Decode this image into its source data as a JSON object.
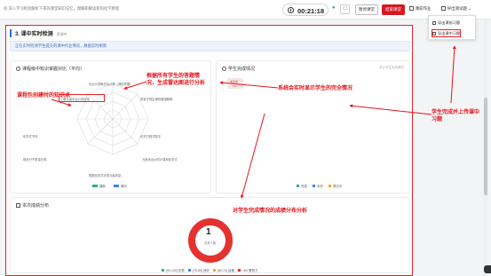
{
  "topbar": {
    "lesson_text": "风 深入学习经验解析下来的课堂知识记忆，理解和解读新的化学原理",
    "timer": "00:21:18",
    "pause_label": "暂停课堂",
    "end_label": "结束课堂",
    "menu": [
      "课前作业",
      "导出测试题"
    ]
  },
  "dropdown": {
    "options": [
      "导出课前习题",
      "导出课中习题"
    ]
  },
  "section": {
    "title": "3. 课中实时检测",
    "subtitle": "资源中",
    "info": "正在实时检测学生提交的课中作业情况，数据实时刷新"
  },
  "radar_card": {
    "title": "课程级中知识掌握对比（平均）",
    "labels": [
      "化合价的概念及计算（课前掌握）",
      "了解元素化合价的应用",
      "质量守恒定律的微观解释",
      "化学方程式配平",
      "元素化合价的计算和化学式",
      "根据化学式计算元素质量",
      "相对分子质量计算",
      "化学式书写"
    ],
    "legend": [
      {
        "name": "课前",
        "color": "#2ab573"
      },
      {
        "name": "课中",
        "color": "#3b82f6"
      }
    ]
  },
  "completion_card": {
    "title": "学生完成情况",
    "right_label": "共计学生完成情况",
    "tag_line1": "未完成",
    "tag_line2": "0人",
    "legend": [
      {
        "name": "完成",
        "color": "#2ab573"
      },
      {
        "name": "未完",
        "color": "#3b82f6"
      },
      {
        "name": "提交中",
        "color": "#f5a623"
      }
    ]
  },
  "score_card": {
    "title": "本次成绩分布",
    "donut_value": "1",
    "donut_label": "总考人数",
    "legend": [
      {
        "name": "[90-100] 优秀",
        "color": "#2ab573"
      },
      {
        "name": "[75-89] 良好",
        "color": "#3b82f6"
      },
      {
        "name": "[60-74] 及格",
        "color": "#f5a623"
      },
      {
        "name": "<60 需努力",
        "color": "#e03131"
      }
    ],
    "colors": {
      "ring": "#e3322f"
    }
  },
  "annotations": {
    "knowledge": "课程包创建时的知识点",
    "radar": "根据所有学生的答题情况，生成雷达图进行分析",
    "completion": "系统会实时显示学生的完全情况",
    "upload": "学生完成并上传课中习题",
    "distribution": "对学生完成情况的成绩分布分析"
  }
}
